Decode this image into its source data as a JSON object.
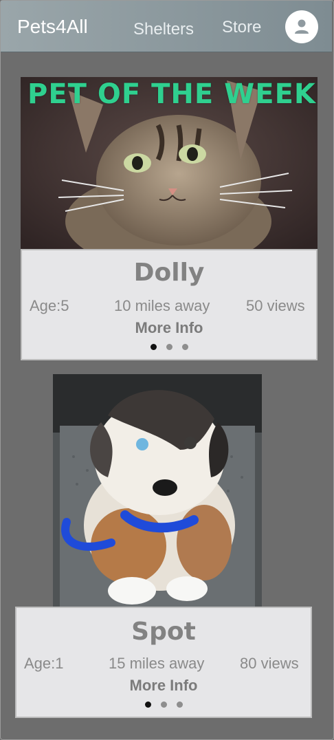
{
  "header": {
    "brand": "Pets4All",
    "nav": [
      "Shelters",
      "Store"
    ]
  },
  "featured": {
    "banner": "PET OF THE WEEK",
    "name": "Dolly",
    "age": "Age:5",
    "distance": "10 miles away",
    "views": "50 views",
    "more_info": "More Info"
  },
  "second": {
    "name": "Spot",
    "age": "Age:1",
    "distance": "15 miles away",
    "views": "80 views",
    "more_info": "More Info"
  },
  "colors": {
    "banner": "#2fd08f",
    "background": "#6d6d6d",
    "card": "#e6e6e8"
  },
  "icons": {
    "avatar": "user-avatar-icon"
  }
}
